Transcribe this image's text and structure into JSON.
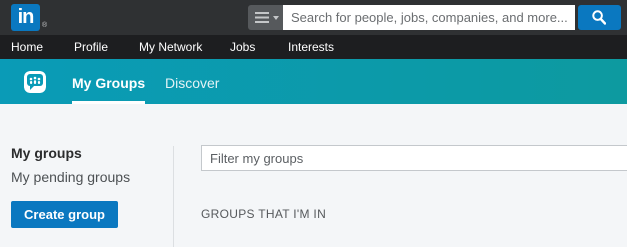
{
  "header": {
    "logo_text": "in",
    "logo_reg": "®",
    "search_placeholder": "Search for people, jobs, companies, and more..."
  },
  "nav": {
    "items": [
      {
        "label": "Home"
      },
      {
        "label": "Profile"
      },
      {
        "label": "My Network"
      },
      {
        "label": "Jobs"
      },
      {
        "label": "Interests"
      }
    ]
  },
  "groups_nav": {
    "tabs": [
      {
        "label": "My Groups",
        "active": true
      },
      {
        "label": "Discover",
        "active": false
      }
    ]
  },
  "sidebar": {
    "title": "My groups",
    "link": "My pending groups",
    "create_button": "Create group"
  },
  "main": {
    "filter_placeholder": "Filter my groups",
    "section_heading": "GROUPS THAT I'M IN"
  },
  "colors": {
    "brand_blue": "#0a78c0",
    "header_dark": "#2f3133",
    "nav_black": "#1d1e20",
    "teal": "#0a9bb7"
  },
  "icons": [
    "linkedin-logo",
    "search-type-menu-icon",
    "search-icon",
    "groups-icon"
  ]
}
